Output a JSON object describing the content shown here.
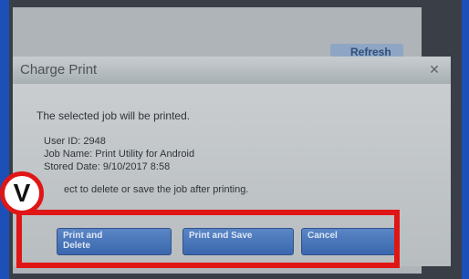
{
  "header": {
    "refresh_label": "Refresh"
  },
  "dialog": {
    "title": "Charge Print",
    "message": "The selected job will be printed.",
    "details": {
      "user_id": "User ID: 2948",
      "job_name": "Job Name: Print Utility for Android",
      "stored_date": "Stored Date: 9/10/2017 8:58"
    },
    "instruction": "ect to delete or save the job after printing.",
    "buttons": {
      "print_and_delete_line1": "Print and",
      "print_and_delete_line2": "Delete",
      "print_and_save": "Print and Save",
      "cancel": "Cancel"
    }
  },
  "annotation": {
    "marker": "V"
  },
  "colors": {
    "highlight": "#e01616",
    "button": "#3a67ad",
    "background": "#1d4fb8"
  }
}
